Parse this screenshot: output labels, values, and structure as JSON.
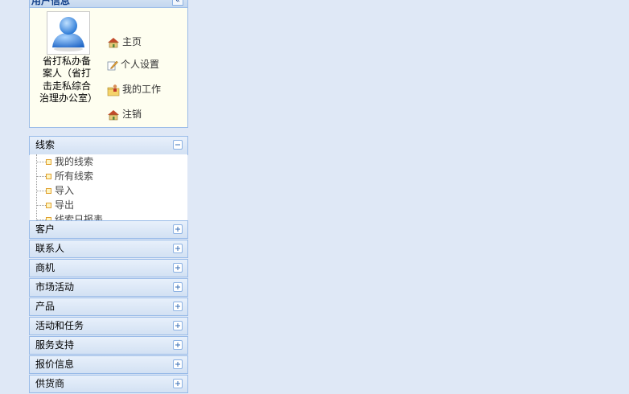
{
  "user_panel": {
    "title": "用户信息",
    "user_name": "省打私办备案人（省打击走私综合治理办公室）",
    "links": [
      {
        "label": "主页",
        "icon": "home-icon"
      },
      {
        "label": "个人设置",
        "icon": "edit-icon"
      },
      {
        "label": "我的工作",
        "icon": "folder-user-icon"
      },
      {
        "label": "注销",
        "icon": "logout-home-icon"
      }
    ]
  },
  "accordion": {
    "expanded": {
      "label": "线索",
      "items": [
        "我的线索",
        "所有线索",
        "导入",
        "导出",
        "线索日报表"
      ]
    },
    "sections": [
      "客户",
      "联系人",
      "商机",
      "市场活动",
      "产品",
      "活动和任务",
      "服务支持",
      "报价信息",
      "供货商"
    ]
  },
  "colors": {
    "panel_border": "#99bbe8",
    "background": "#dfe8f6",
    "user_bg": "#fefef0"
  }
}
